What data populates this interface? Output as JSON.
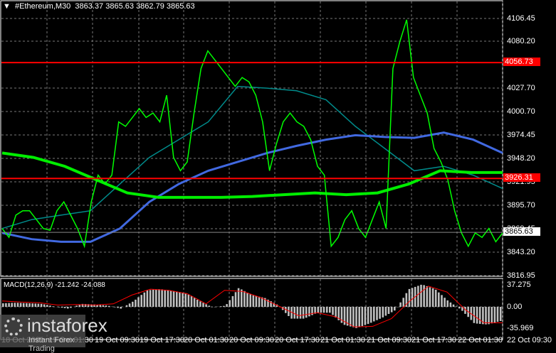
{
  "header": {
    "symbol": "#Ethereum,M30",
    "open": "3863.37",
    "high": "3865.63",
    "low": "3862.79",
    "close": "3865.63"
  },
  "price_axis": [
    "4106.45",
    "4080.20",
    "4027.70",
    "4000.70",
    "3974.45",
    "3948.20",
    "3921.95",
    "3895.70",
    "3869.45",
    "3843.20",
    "3816.95"
  ],
  "levels": {
    "upper": "4056.73",
    "lower": "3926.31",
    "current": "3865.63"
  },
  "macd": {
    "label": "MACD(12,26,9) -21.242 -24.088",
    "axis": [
      "37.275",
      "0.00",
      "-35.969"
    ]
  },
  "time_axis": [
    "18 Oct 2021",
    "19 Oct 01:30",
    "19 Oct 09:30",
    "19 Oct 17:30",
    "20 Oct 01:30",
    "20 Oct 09:30",
    "20 Oct 17:30",
    "21 Oct 01:30",
    "21 Oct 09:30",
    "21 Oct 17:30",
    "22 Oct 01:30",
    "22 Oct 09:30"
  ],
  "logo": {
    "brand": "instaforex",
    "tagline": "Instant Forex Trading"
  },
  "colors": {
    "price": "#00ff00",
    "ma_green": "#00ee00",
    "ma_blue": "#4169e1",
    "ma_teal": "#008b8b",
    "level": "#ff0000",
    "hist": "#c0c0c0",
    "signal": "#ff0000"
  },
  "chart_data": {
    "type": "line",
    "price_range": [
      3816.95,
      4106.45
    ],
    "price": [
      3870,
      3860,
      3885,
      3890,
      3890,
      3880,
      3870,
      3868,
      3890,
      3900,
      3885,
      3870,
      3850,
      3900,
      3930,
      3920,
      3930,
      3990,
      3985,
      3995,
      4005,
      3995,
      4000,
      3990,
      4020,
      3950,
      3935,
      3945,
      4000,
      4050,
      4070,
      4060,
      4050,
      4040,
      4030,
      4040,
      4035,
      4020,
      3990,
      3935,
      3965,
      3990,
      4000,
      3990,
      3985,
      3970,
      3940,
      3930,
      3850,
      3860,
      3880,
      3890,
      3870,
      3860,
      3880,
      3900,
      3870,
      4050,
      4080,
      4105,
      4040,
      4020,
      4000,
      3960,
      3945,
      3925,
      3890,
      3865,
      3850,
      3865,
      3860,
      3870,
      3855,
      3865
    ],
    "ma_green": [
      3955,
      3950,
      3940,
      3925,
      3910,
      3905,
      3905,
      3905,
      3906,
      3908,
      3910,
      3908,
      3910,
      3920,
      3935,
      3933,
      3933
    ],
    "ma_blue": [
      3865,
      3858,
      3855,
      3855,
      3870,
      3900,
      3920,
      3935,
      3945,
      3955,
      3963,
      3970,
      3975,
      3973,
      3972,
      3978,
      3970,
      3955
    ],
    "ma_teal": [
      3870,
      3880,
      3885,
      3890,
      3920,
      3950,
      3970,
      3990,
      4030,
      4028,
      4025,
      4015,
      3985,
      3960,
      3935,
      3940,
      3930,
      3915
    ],
    "macd_hist": [
      6,
      7,
      6,
      5,
      0,
      -3,
      5,
      4,
      2,
      -3,
      10,
      28,
      30,
      27,
      23,
      10,
      -1,
      2,
      32,
      20,
      15,
      3,
      -20,
      -20,
      -10,
      -10,
      -30,
      -36,
      -28,
      -18,
      -5,
      30,
      38,
      30,
      10,
      -5,
      -28,
      -30,
      -24
    ],
    "macd_signal": [
      10,
      8,
      7,
      3,
      4,
      3,
      5,
      20,
      30,
      28,
      22,
      5,
      28,
      26,
      15,
      0,
      -15,
      -10,
      -17,
      -34,
      -33,
      -20,
      10,
      35,
      25,
      -5,
      -27,
      -27
    ]
  }
}
